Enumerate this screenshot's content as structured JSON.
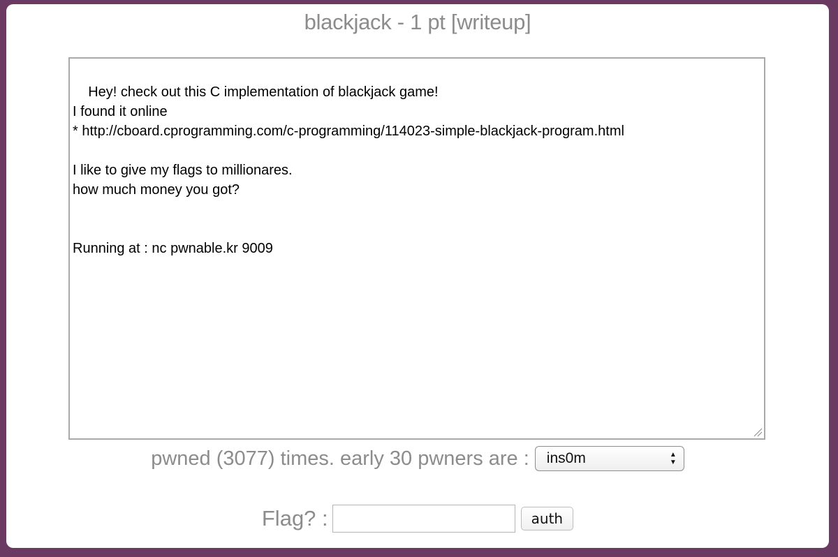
{
  "challenge": {
    "title": "blackjack - 1 pt [writeup]",
    "description": "Hey! check out this C implementation of blackjack game!\nI found it online\n* http://cboard.cprogramming.com/c-programming/114023-simple-blackjack-program.html\n\nI like to give my flags to millionares.\nhow much money you got?\n\n\nRunning at : nc pwnable.kr 9009"
  },
  "stats": {
    "pwned_text": "pwned (3077) times. early 30 pwners are :",
    "selected_pwner": "ins0m"
  },
  "flag": {
    "label": "Flag? :",
    "input_value": "",
    "auth_label": "auth"
  },
  "colors": {
    "background": "#6b3a63",
    "muted_text": "#8c8c8c"
  }
}
